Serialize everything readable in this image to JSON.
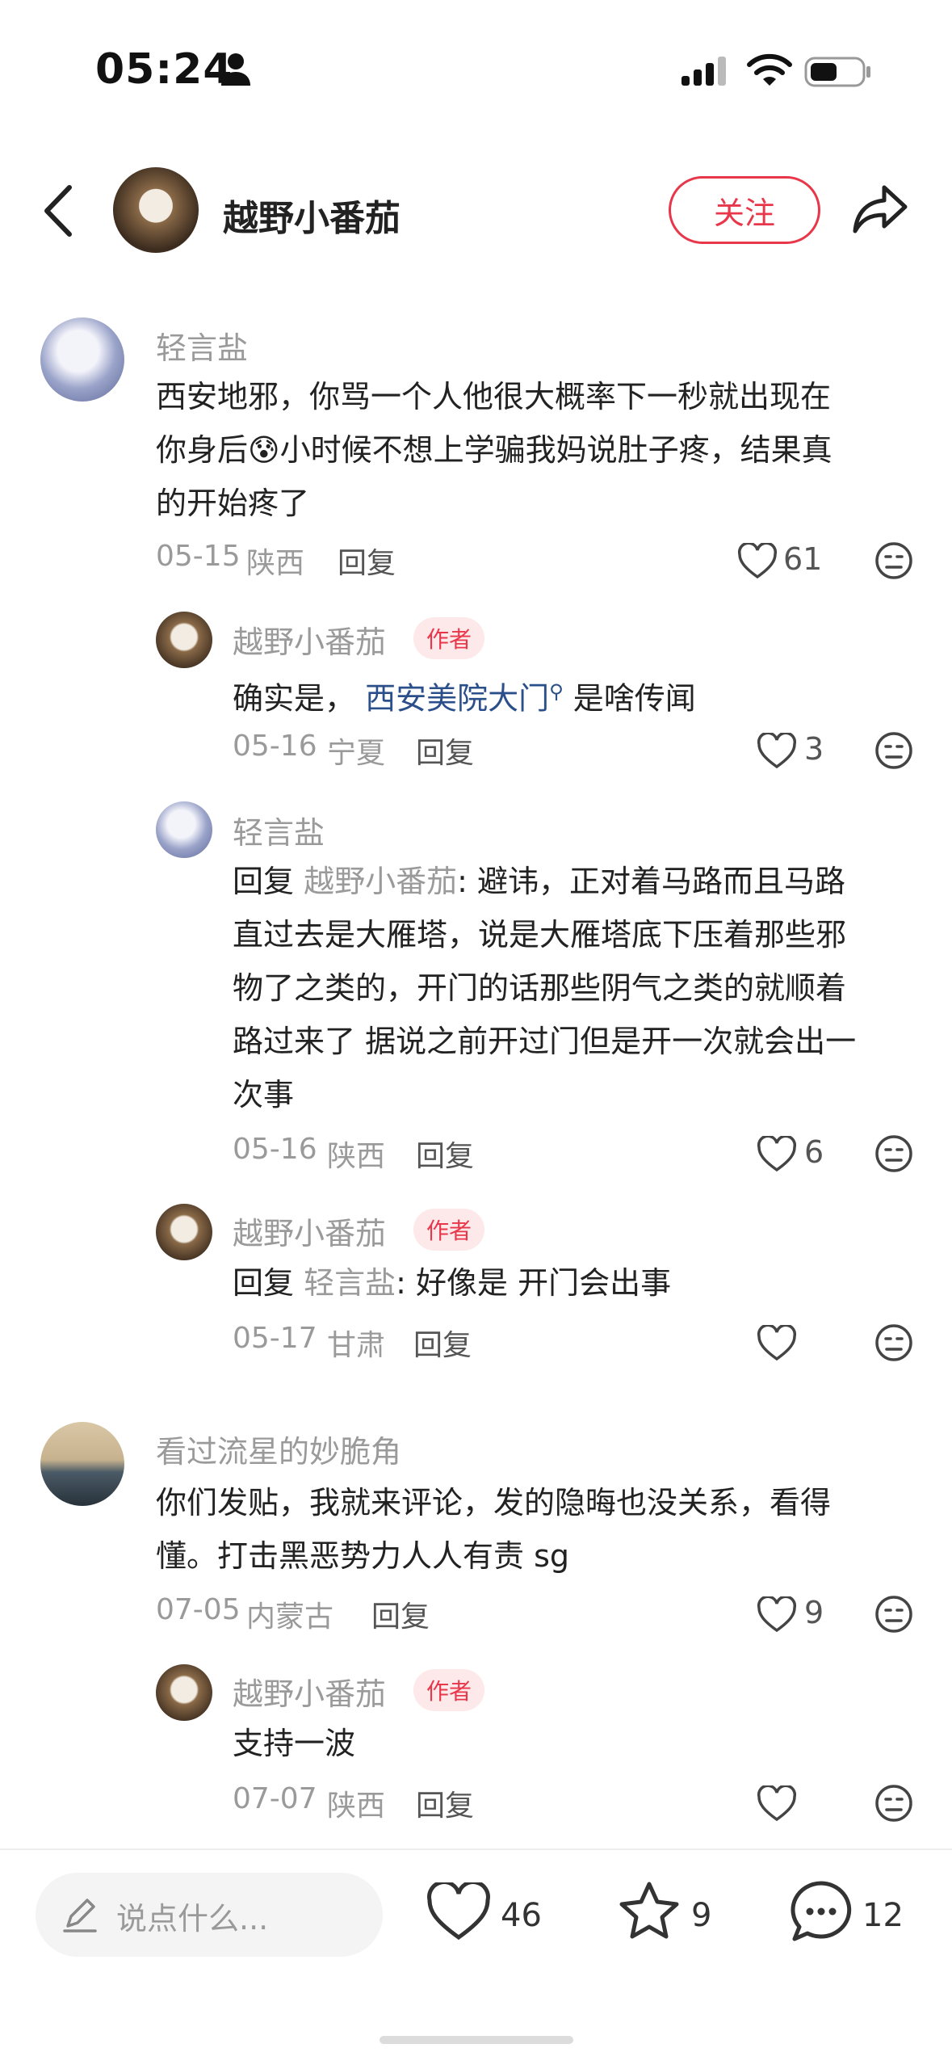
{
  "status_bar": {
    "time": "05:24"
  },
  "header": {
    "author_name": "越野小番茄",
    "follow_label": "关注"
  },
  "comments": [
    {
      "user": "轻言盐",
      "text_lines": [
        "西安地邪，你骂一个人他很大概率下一秒就出现在",
        "你身后😰小时候不想上学骗我妈说肚子疼，结果真",
        "的开始疼了"
      ],
      "date": "05-15",
      "location": "陕西",
      "reply_label": "回复",
      "likes": "61",
      "replies": [
        {
          "user": "越野小番茄",
          "tag": "作者",
          "text_prefix": "确实是，",
          "link_text": "西安美院大门",
          "text_suffix": "是啥传闻",
          "date": "05-16",
          "location": "宁夏",
          "reply_label": "回复",
          "likes": "3"
        },
        {
          "user": "轻言盐",
          "reply_prefix": "回复",
          "reply_to": "越野小番茄",
          "text_lines": [
            ": 避讳，正对着马路而且马路",
            "直过去是大雁塔，说是大雁塔底下压着那些邪",
            "物了之类的，开门的话那些阴气之类的就顺着",
            "路过来了 据说之前开过门但是开一次就会出一",
            "次事"
          ],
          "date": "05-16",
          "location": "陕西",
          "reply_label": "回复",
          "likes": "6"
        },
        {
          "user": "越野小番茄",
          "tag": "作者",
          "reply_prefix": "回复",
          "reply_to": "轻言盐",
          "text": ": 好像是 开门会出事",
          "date": "05-17",
          "location": "甘肃",
          "reply_label": "回复"
        }
      ]
    },
    {
      "user": "看过流星的妙脆角",
      "text_lines": [
        "你们发贴，我就来评论，发的隐晦也没关系，看得",
        "懂。打击黑恶势力人人有责 sg"
      ],
      "date": "07-05",
      "location": "内蒙古",
      "reply_label": "回复",
      "likes": "9",
      "replies": [
        {
          "user": "越野小番茄",
          "tag": "作者",
          "text": "支持一波",
          "date": "07-07",
          "location": "陕西",
          "reply_label": "回复"
        }
      ]
    }
  ],
  "bottom_bar": {
    "input_placeholder": "说点什么...",
    "likes": "46",
    "favorites": "9",
    "comments": "12"
  }
}
